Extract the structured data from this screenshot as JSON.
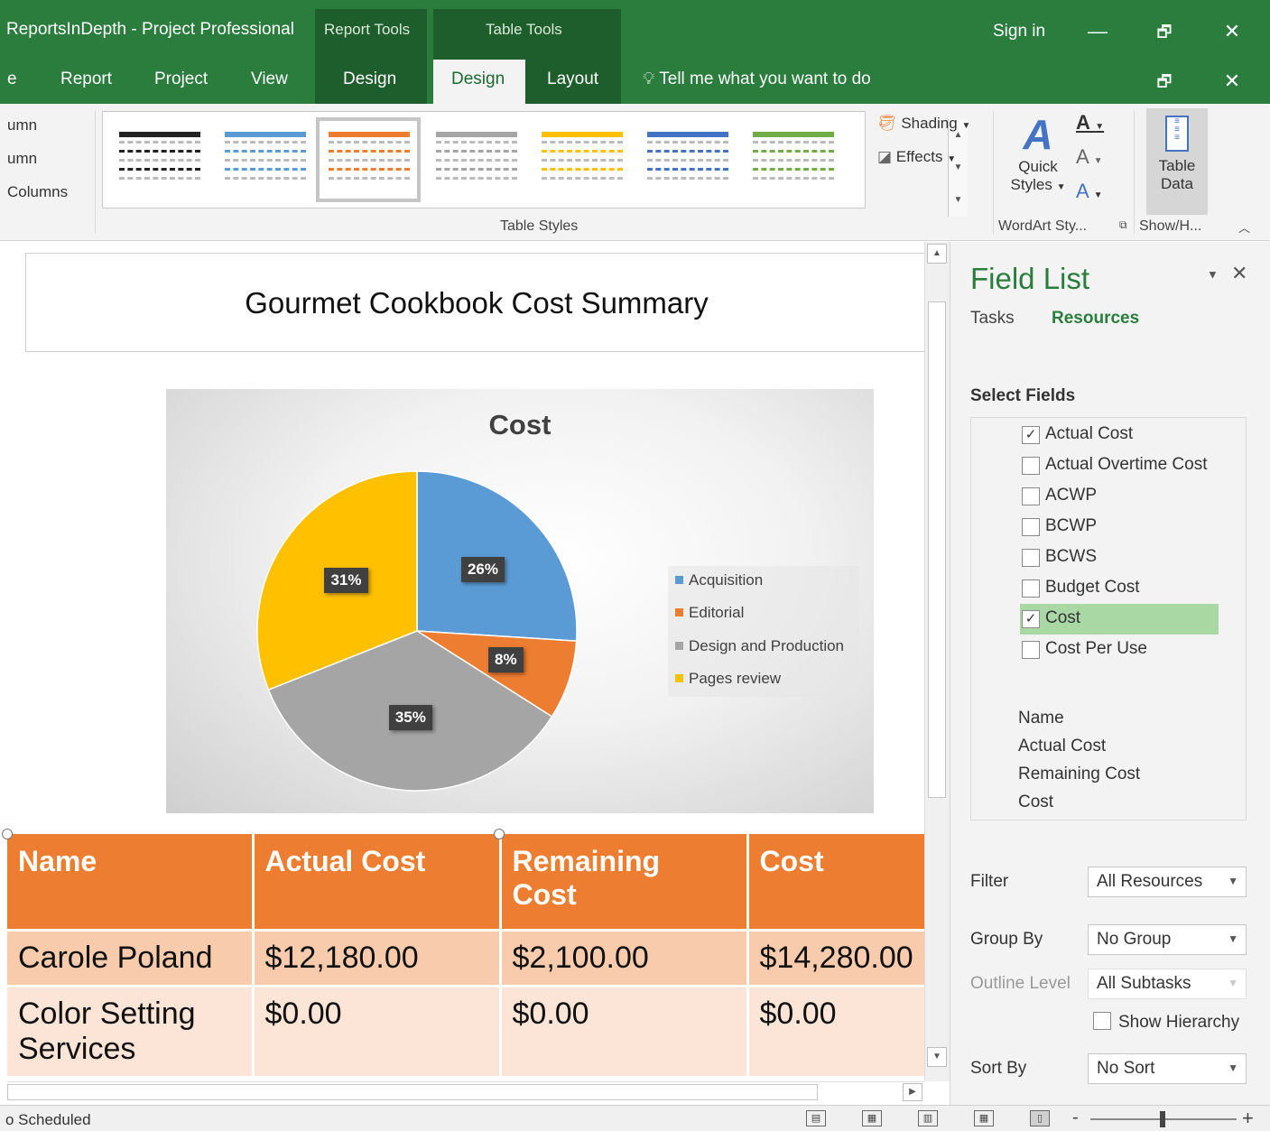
{
  "window": {
    "title": "ReportsInDepth - Project Professional",
    "context_report_tools": "Report Tools",
    "context_table_tools": "Table Tools",
    "sign_in": "Sign in",
    "minimize_glyph": "—",
    "restore_glyph": "🗗",
    "close_glyph": "✕"
  },
  "tabs": {
    "partial": "e",
    "report": "Report",
    "project": "Project",
    "view": "View",
    "report_design": "Design",
    "table_design": "Design",
    "layout": "Layout",
    "tell_me": "Tell me what you want to do"
  },
  "ribbon": {
    "left_items": [
      "umn",
      "umn",
      "Columns"
    ],
    "table_styles_label": "Table Styles",
    "style_colors": [
      "#222222",
      "#5b9bd5",
      "#ed7d31",
      "#a5a5a5",
      "#ffc000",
      "#4472c4",
      "#70ad47"
    ],
    "shading": "Shading",
    "effects": "Effects",
    "quick_styles_1": "Quick",
    "quick_styles_2": "Styles",
    "wordart_label": "WordArt Sty...",
    "table_data_1": "Table",
    "table_data_2": "Data",
    "show_hide_label": "Show/H..."
  },
  "report": {
    "title": "Gourmet Cookbook Cost Summary"
  },
  "chart_data": {
    "type": "pie",
    "title": "Cost",
    "categories": [
      "Acquisition",
      "Editorial",
      "Design and Production",
      "Pages review"
    ],
    "values": [
      26,
      8,
      35,
      31
    ],
    "value_labels": [
      "26%",
      "8%",
      "35%",
      "31%"
    ],
    "colors": [
      "#5b9bd5",
      "#ed7d31",
      "#a5a5a5",
      "#ffc000"
    ],
    "legend_position": "right"
  },
  "table": {
    "headers": [
      "Name",
      "Actual Cost",
      "Remaining",
      "Cost",
      "Cost"
    ],
    "header_remaining_line2": "Cost",
    "rows": [
      {
        "name": "Carole Poland",
        "actual": "$12,180.00",
        "remaining": "$2,100.00",
        "cost": "$14,280.00"
      },
      {
        "name_1": "Color Setting",
        "name_2": "Services",
        "actual": "$0.00",
        "remaining": "$0.00",
        "cost": "$0.00"
      }
    ]
  },
  "field_list": {
    "title": "Field List",
    "tab_tasks": "Tasks",
    "tab_resources": "Resources",
    "select_fields": "Select Fields",
    "fields": [
      {
        "label": "Actual Cost",
        "checked": "✓"
      },
      {
        "label": "Actual Overtime Cost",
        "checked": ""
      },
      {
        "label": "ACWP",
        "checked": ""
      },
      {
        "label": "BCWP",
        "checked": ""
      },
      {
        "label": "BCWS",
        "checked": ""
      },
      {
        "label": "Budget Cost",
        "checked": ""
      },
      {
        "label": "Cost",
        "checked": "✓"
      },
      {
        "label": "Cost Per Use",
        "checked": ""
      }
    ],
    "selected": [
      "Name",
      "Actual Cost",
      "Remaining Cost",
      "Cost"
    ],
    "filter_label": "Filter",
    "filter_value": "All Resources",
    "group_label": "Group By",
    "group_value": "No Group",
    "outline_label": "Outline Level",
    "outline_value": "All Subtasks",
    "show_hierarchy": "Show Hierarchy",
    "sort_label": "Sort By",
    "sort_value": "No Sort"
  },
  "status": {
    "text": "o Scheduled",
    "zoom_minus": "-",
    "zoom_plus": "+"
  }
}
